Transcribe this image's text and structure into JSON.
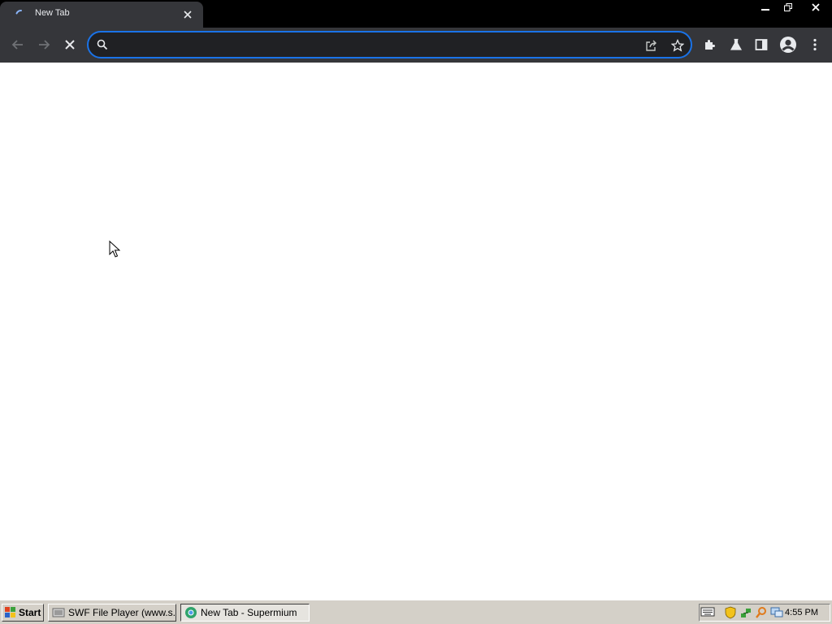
{
  "browser": {
    "tab": {
      "title": "New Tab"
    },
    "omnibox": {
      "value": "",
      "placeholder": ""
    }
  },
  "taskbar": {
    "start_label": "Start",
    "tasks": [
      {
        "label": "SWF File Player (www.s..."
      },
      {
        "label": "New Tab - Supermium"
      }
    ],
    "clock": "4:55 PM"
  },
  "colors": {
    "titlebar": "#000000",
    "toolbar": "#35363a",
    "omnibox_border": "#1a73e8",
    "omnibox_bg": "#202124",
    "taskbar": "#d4d0c8"
  },
  "icons": {
    "tab": "loading-spinner-icon",
    "toolbar": [
      "back-icon",
      "forward-icon",
      "stop-icon",
      "search-icon",
      "share-icon",
      "star-icon",
      "extensions-icon",
      "labs-flask-icon",
      "side-panel-icon",
      "profile-icon",
      "menu-icon"
    ],
    "tray": [
      "keyboard-icon",
      "security-shield-icon",
      "network-icon",
      "search-tray-icon",
      "display-icon"
    ]
  }
}
